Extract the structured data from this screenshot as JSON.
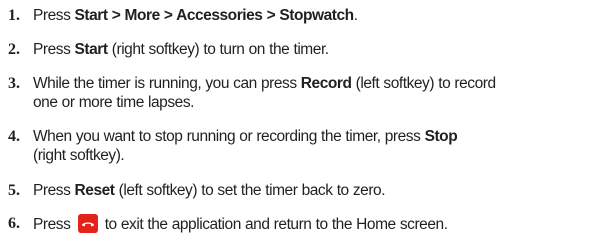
{
  "steps": [
    {
      "number": "1.",
      "parts": [
        "Press ",
        "Start > More > Accessories > Stopwatch",
        "."
      ]
    },
    {
      "number": "2.",
      "parts": [
        "Press ",
        "Start",
        " (right softkey) to turn on the timer."
      ]
    },
    {
      "number": "3.",
      "parts": [
        "While the timer is running, you can press ",
        "Record",
        " (left softkey) to record",
        "one or more time lapses."
      ]
    },
    {
      "number": "4.",
      "parts": [
        "When you want to stop running or recording the timer, press ",
        "Stop",
        "(right softkey)."
      ]
    },
    {
      "number": "5.",
      "parts": [
        "Press ",
        "Reset",
        " (left softkey) to set the timer back to zero."
      ]
    },
    {
      "number": "6.",
      "parts": [
        "Press ",
        " to exit the application and return to the Home screen."
      ],
      "icon": "end-call-key-icon",
      "icon_color": "#e2231a"
    }
  ]
}
